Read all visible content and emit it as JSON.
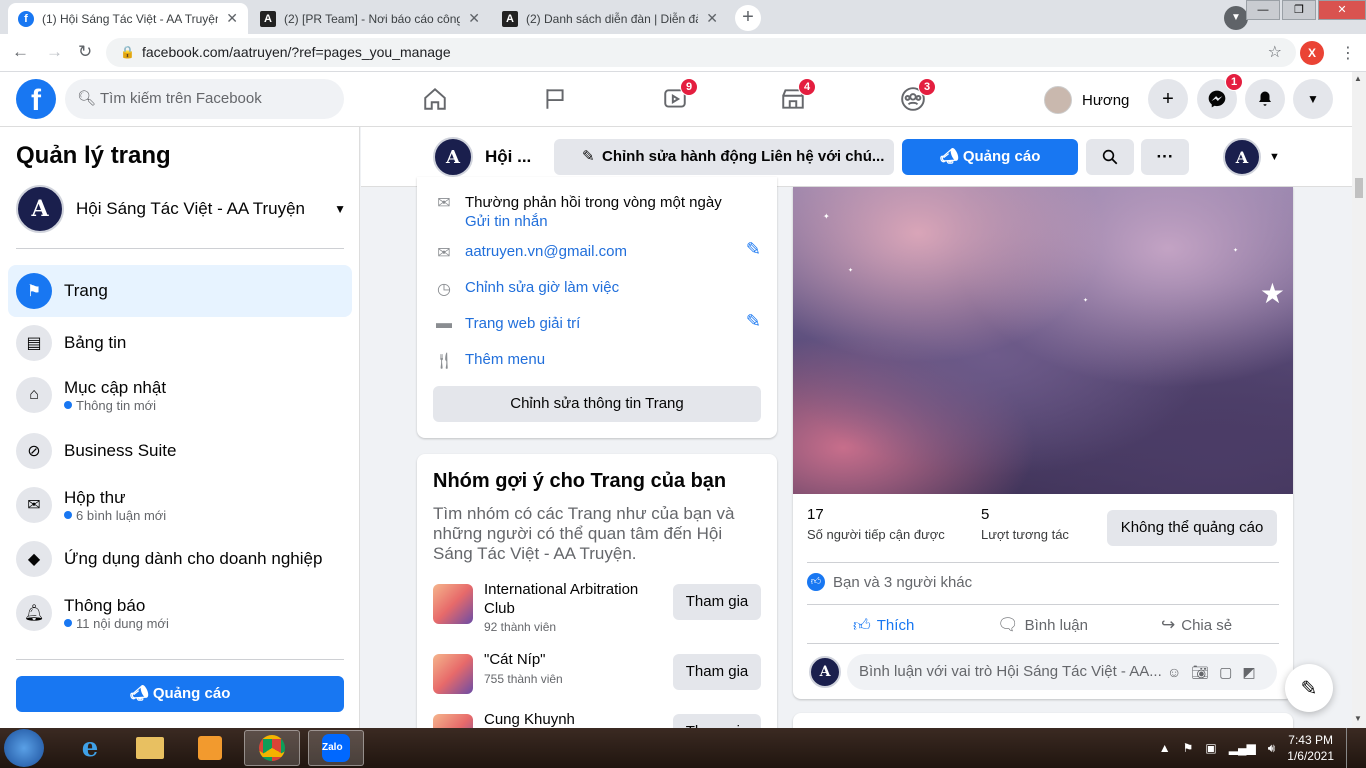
{
  "browser": {
    "tabs": [
      {
        "title": "(1) Hội Sáng Tác Việt - AA Truyện",
        "active": true,
        "favicon": "f"
      },
      {
        "title": "(2) [PR Team] - Nơi báo cáo công",
        "active": false,
        "favicon": "A"
      },
      {
        "title": "(2) Danh sách diễn đàn | Diễn đàn",
        "active": false,
        "favicon": "A"
      }
    ],
    "url": "facebook.com/aatruyen/?ref=pages_you_manage",
    "extension_label": "X"
  },
  "fb_nav": {
    "search_placeholder": "Tìm kiếm trên Facebook",
    "badges": {
      "watch": "9",
      "marketplace": "4",
      "groups": "3",
      "messenger": "1"
    },
    "profile_name": "Hương"
  },
  "sidebar": {
    "title": "Quản lý trang",
    "page_name": "Hội Sáng Tác Việt - AA Truyện",
    "items": [
      {
        "label": "Trang",
        "sub": ""
      },
      {
        "label": "Bảng tin",
        "sub": ""
      },
      {
        "label": "Mục cập nhật",
        "sub": "Thông tin mới"
      },
      {
        "label": "Business Suite",
        "sub": ""
      },
      {
        "label": "Hộp thư",
        "sub": "6 bình luận mới"
      },
      {
        "label": "Ứng dụng dành cho doanh nghiệp",
        "sub": ""
      },
      {
        "label": "Thông báo",
        "sub": "11 nội dung mới"
      }
    ],
    "ad_button": "Quảng cáo"
  },
  "page_bar": {
    "name": "Hội ...",
    "edit_action": "Chỉnh sửa hành động Liên hệ với chú...",
    "ad_button": "Quảng cáo",
    "more": "···"
  },
  "info_card": {
    "response": "Thường phản hồi trong vòng một ngày",
    "send_message": "Gửi tin nhắn",
    "email": "aatruyen.vn@gmail.com",
    "hours": "Chỉnh sửa giờ làm việc",
    "category": "Trang web giải trí",
    "menu": "Thêm menu",
    "edit_button": "Chỉnh sửa thông tin Trang"
  },
  "groups_card": {
    "title": "Nhóm gợi ý cho Trang của bạn",
    "desc": "Tìm nhóm có các Trang như của bạn và những người có thể quan tâm đến Hội Sáng Tác Việt - AA Truyện.",
    "join_label": "Tham gia",
    "groups": [
      {
        "name": "International Arbitration Club",
        "members": "92 thành viên"
      },
      {
        "name": "\"Cát Níp\"",
        "members": "755 thành viên"
      },
      {
        "name": "Cung Khuynh",
        "members": ""
      }
    ]
  },
  "post": {
    "reach_value": "17",
    "reach_label": "Số người tiếp cận được",
    "engagement_value": "5",
    "engagement_label": "Lượt tương tác",
    "boost_button": "Không thể quảng cáo",
    "reactions": "Bạn và 3 người khác",
    "like": "Thích",
    "comment": "Bình luận",
    "share": "Chia sẻ",
    "comment_placeholder": "Bình luận với vai trò Hội Sáng Tác Việt - AA..."
  },
  "taskbar": {
    "time": "7:43 PM",
    "date": "1/6/2021",
    "zalo": "Zalo"
  },
  "colors": {
    "fb_blue": "#1877f2",
    "link_blue": "#216fdb",
    "badge_red": "#e41e3f"
  }
}
